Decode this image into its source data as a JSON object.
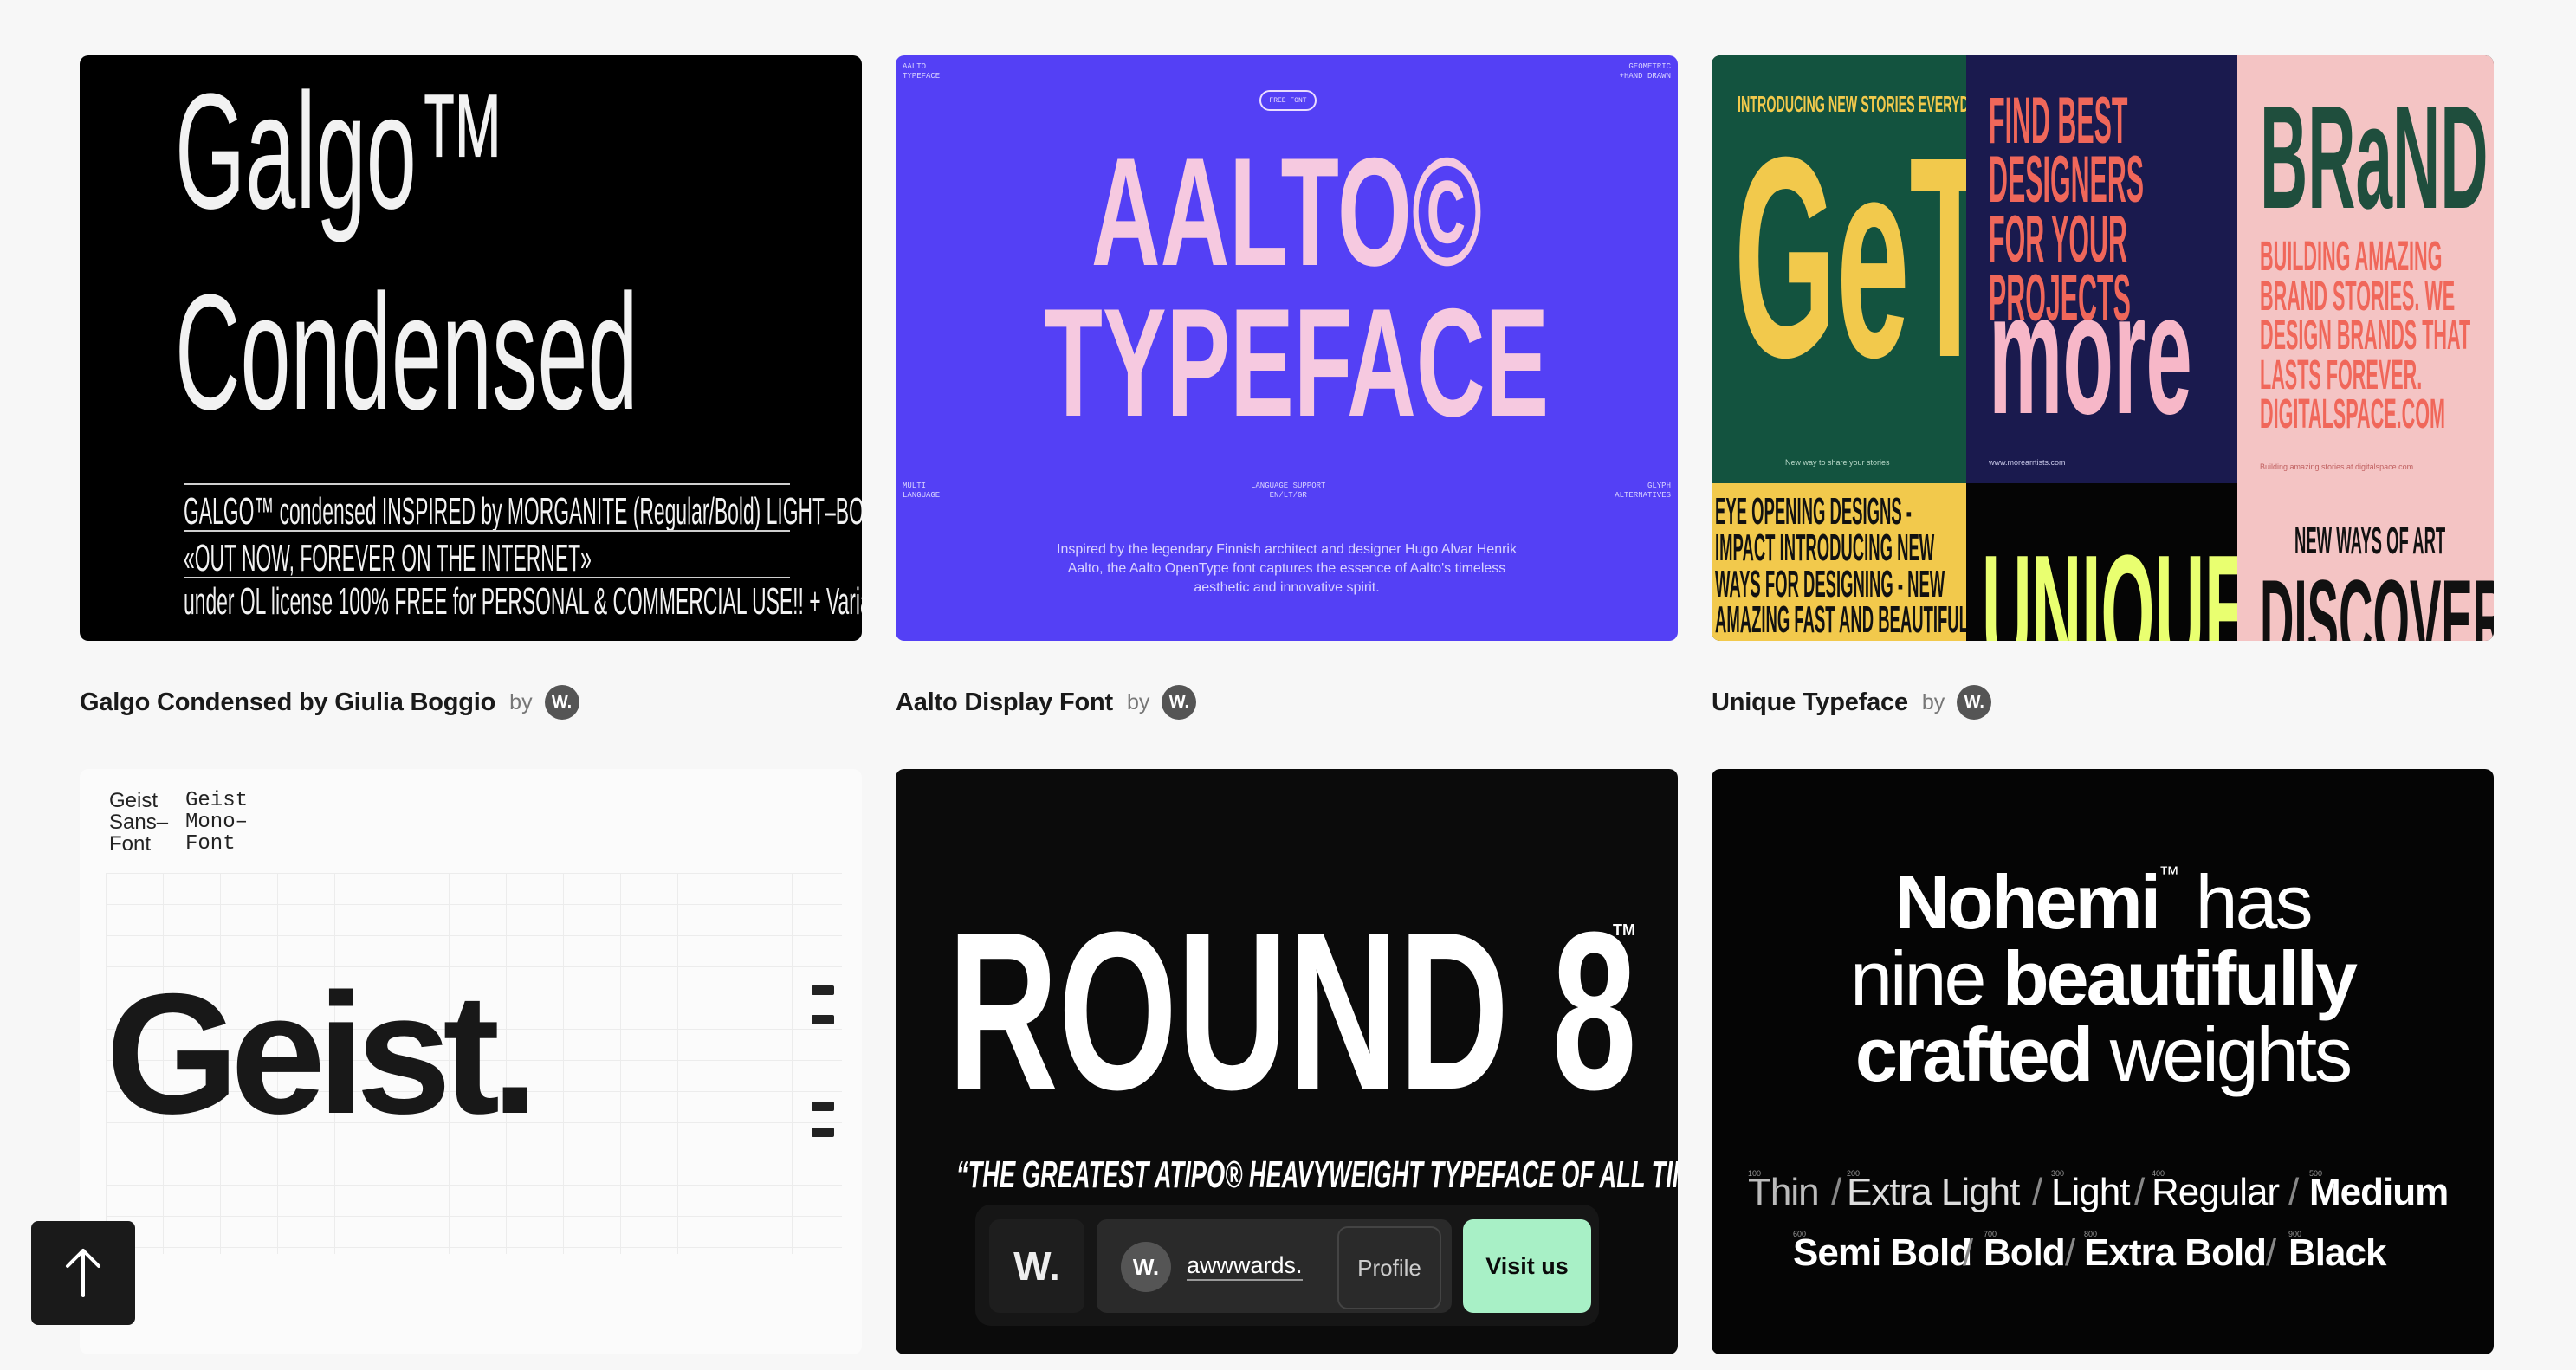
{
  "cards": [
    {
      "title": "Galgo Condensed by Giulia Boggio",
      "by": "by",
      "avatar": "W.",
      "thumb": {
        "line1": "Galgo™",
        "line2": "Condensed",
        "row1": "GALGO™ condensed INSPIRED by MORGANITE (Regular/Bold) LIGHT–BOLD",
        "row2": "«OUT NOW, FOREVER ON THE INTERNET»",
        "row3": "under OL license 100% FREE for PERSONAL & COMMERCIAL USE!! + Variable"
      }
    },
    {
      "title": "Aalto Display Font",
      "by": "by",
      "avatar": "W.",
      "thumb": {
        "corner_tl": "AALTO\nTYPEFACE",
        "corner_tr": "GEOMETRIC\n+HAND DRAWN",
        "pill": "FREE FONT",
        "line1": "AALTO©",
        "line2": "TYPEFACE",
        "bl": "MULTI\nLANGUAGE",
        "bc": "LANGUAGE SUPPORT\nEN/LT/GR",
        "br": "GLYPH\nALTERNATIVES",
        "desc": "Inspired by the legendary Finnish architect and designer Hugo Alvar Henrik Aalto, the Aalto OpenType font captures the essence of Aalto's timeless aesthetic and innovative spirit."
      }
    },
    {
      "title": "Unique Typeface",
      "by": "by",
      "avatar": "W.",
      "thumb": {
        "p1_top": "INTRODUCING NEW STORIES EVERYDAY",
        "p1_big": "GeT",
        "p1_small": "New way to share your stories",
        "p2_top": "FIND BEST DESIGNERS FOR YOUR PROJECTS",
        "p2_big": "more",
        "p2_small": "www.morearrtists.com",
        "p3_big": "BRaND",
        "p3_mid": "BUILDING AMAZING BRAND STORIES. WE DESIGN BRANDS THAT LASTS FOREVER. DIGITALSPACE.COM",
        "p3_small": "Building amazing stories at digitalspace.com",
        "p4_text": "EYE OPENING DESIGNS - IMPACT INTRODUCING NEW WAYS FOR DESIGNING - NEW AMAZING FAST AND BEAUTIFUL APPS - EVERYONE",
        "p5_big": "UNIQUE",
        "p6_top": "NEW WAYS OF ART",
        "p6_big": "DISCOVER"
      }
    },
    {
      "title": "",
      "thumb": {
        "hdr_left": "Geist\nSans–\nFont",
        "hdr_right": "Geist\nMono–\nFont",
        "word": "Geist."
      }
    },
    {
      "title": "",
      "thumb": {
        "big": "ROUND 8",
        "tm": "TM",
        "sub": "“THE GREATEST ATIPO® HEAVYWEIGHT TYPEFACE OF ALL TIME”",
        "logo": "W.",
        "aw_avatar": "W.",
        "aw_name": "awwwards.",
        "profile": "Profile",
        "visit": "Visit us"
      }
    },
    {
      "title": "",
      "thumb": {
        "l1a": "Nohemi",
        "l1tm": "™",
        "l1b": " has",
        "l2a": "nine ",
        "l2b": "beautifully",
        "l3a": "crafted",
        "l3b": " weights",
        "weights": [
          "Thin",
          "Extra Light",
          "Light",
          "Regular",
          "Medium",
          "Semi Bold",
          "Bold",
          "Extra Bold",
          "Black"
        ],
        "nums": [
          "100",
          "200",
          "300",
          "400",
          "500",
          "600",
          "700",
          "800",
          "900"
        ]
      }
    }
  ]
}
